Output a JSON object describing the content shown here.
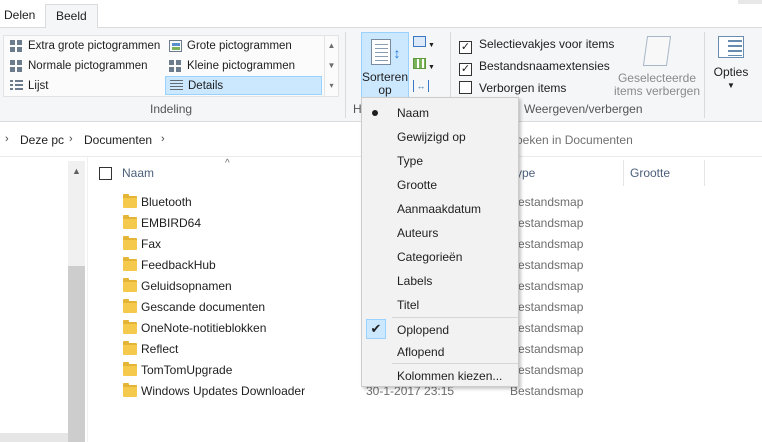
{
  "tabs": [
    "Delen",
    "Beeld"
  ],
  "layout": {
    "items": [
      {
        "label": "Extra grote pictogrammen",
        "icon": "extra-large-icons-icon"
      },
      {
        "label": "Grote pictogrammen",
        "icon": "large-icons-icon"
      },
      {
        "label": "Normale pictogrammen",
        "icon": "medium-icons-icon"
      },
      {
        "label": "Kleine pictogrammen",
        "icon": "small-icons-icon"
      },
      {
        "label": "Lijst",
        "icon": "list-icon"
      },
      {
        "label": "Details",
        "icon": "details-icon",
        "selected": true
      }
    ],
    "group_label": "Indeling"
  },
  "view": {
    "group_label_partial": "H",
    "sort_button": "Sorteren op"
  },
  "show_hide": {
    "checkboxes": [
      {
        "label": "Selectievakjes voor items",
        "checked": true
      },
      {
        "label": "Bestandsnaamextensies",
        "checked": true
      },
      {
        "label": "Verborgen items",
        "checked": false
      }
    ],
    "hide_selected": "Geselecteerde items verbergen",
    "group_label": "Weergeven/verbergen"
  },
  "options_button": "Opties",
  "address": {
    "crumbs": [
      "Deze pc",
      "Documenten"
    ],
    "search_placeholder": "oeken in Documenten"
  },
  "columns": {
    "name": "Naam",
    "type": "ype",
    "size": "Grootte"
  },
  "files": [
    {
      "name": "Bluetooth",
      "date": "",
      "type": "Bestandsmap"
    },
    {
      "name": "EMBIRD64",
      "date": "",
      "type": "Bestandsmap"
    },
    {
      "name": "Fax",
      "date": "",
      "type": "Bestandsmap"
    },
    {
      "name": "FeedbackHub",
      "date": "",
      "type": "Bestandsmap"
    },
    {
      "name": "Geluidsopnamen",
      "date": "",
      "type": "Bestandsmap"
    },
    {
      "name": "Gescande documenten",
      "date": "",
      "type": "Bestandsmap"
    },
    {
      "name": "OneNote-notitieblokken",
      "date": "",
      "type": "Bestandsmap"
    },
    {
      "name": "Reflect",
      "date": "",
      "type": "Bestandsmap"
    },
    {
      "name": "TomTomUpgrade",
      "date": "",
      "type": "Bestandsmap"
    },
    {
      "name": "Windows Updates Downloader",
      "date": "30-1-2017 23:15",
      "type": "Bestandsmap"
    }
  ],
  "sort_menu": {
    "fields": [
      "Naam",
      "Gewijzigd op",
      "Type",
      "Grootte",
      "Aanmaakdatum",
      "Auteurs",
      "Categorieën",
      "Labels",
      "Titel"
    ],
    "selected_field": "Naam",
    "order": [
      "Oplopend",
      "Aflopend"
    ],
    "selected_order": "Oplopend",
    "choose_columns": "Kolommen kiezen..."
  },
  "colors": {
    "selection_bg": "#cce8ff",
    "selection_border": "#99d1ff",
    "folder": "#f5c94c",
    "header_text": "#4c607a"
  }
}
